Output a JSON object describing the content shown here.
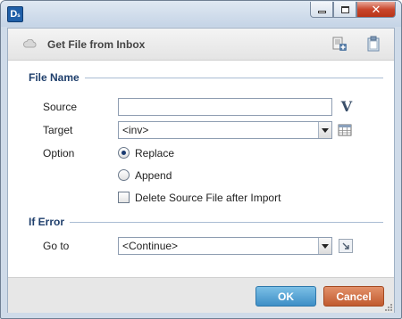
{
  "window": {
    "logo_text": "D",
    "close_glyph": "✕"
  },
  "header": {
    "title": "Get File from Inbox"
  },
  "file_name_section": {
    "title": "File Name",
    "source": {
      "label": "Source",
      "value": "",
      "variable_button": "V"
    },
    "target": {
      "label": "Target",
      "value": "<inv>"
    },
    "option": {
      "label": "Option",
      "choices": [
        {
          "label": "Replace",
          "selected": true
        },
        {
          "label": "Append",
          "selected": false
        }
      ],
      "delete_source": {
        "label": "Delete Source File after Import",
        "checked": false
      }
    }
  },
  "if_error_section": {
    "title": "If Error",
    "goto": {
      "label": "Go to",
      "value": "<Continue>"
    }
  },
  "footer": {
    "ok_label": "OK",
    "cancel_label": "Cancel"
  }
}
